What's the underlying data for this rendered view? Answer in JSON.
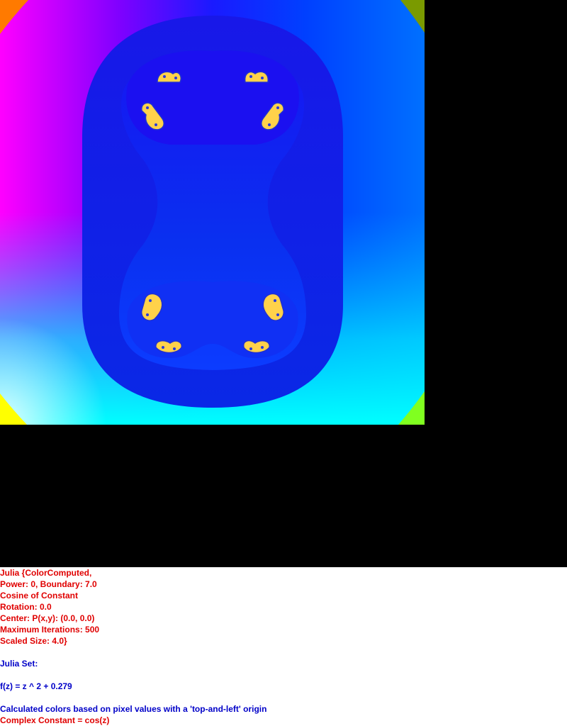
{
  "colors": {
    "parameter_text": "#e00000",
    "description_text": "#0000c8",
    "set_fill": "#ffd24a",
    "background": "#000000"
  },
  "parameters": {
    "line1": "Julia {ColorComputed,",
    "line2": "Power: 0, Boundary: 7.0",
    "line3": "Cosine of Constant",
    "line4": "Rotation: 0.0",
    "line5": "Center: P(x,y): (0.0, 0.0)",
    "line6": "Maximum Iterations: 500",
    "line7": "Scaled Size: 4.0}"
  },
  "description": {
    "set_name": "Julia Set:",
    "function": "f(z) = z ^ 2 + 0.279",
    "color_note": "Calculated colors based on pixel values with a 'top-and-left' origin",
    "constant": "Complex Constant = cos(z)"
  }
}
